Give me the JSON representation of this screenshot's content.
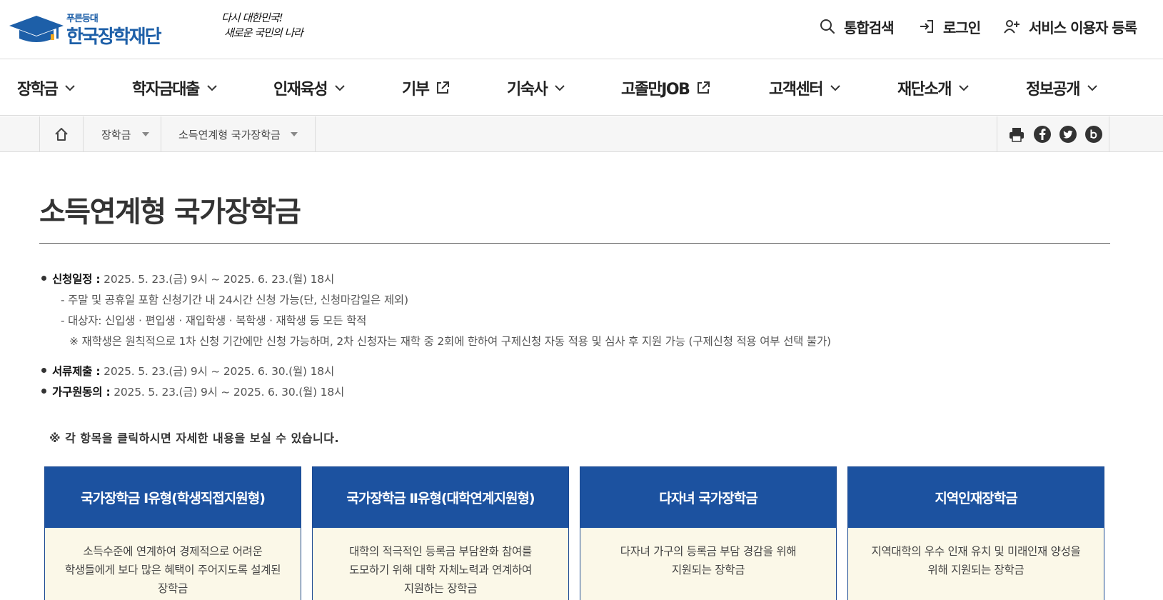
{
  "header": {
    "logo_sub": "푸른등대",
    "logo_main": "한국장학재단",
    "slogan_line1": "다시 대한민국!",
    "slogan_line2": "새로운 국민의 나라",
    "utils": [
      {
        "label": "통합검색",
        "icon": "search-icon"
      },
      {
        "label": "로그인",
        "icon": "login-icon"
      },
      {
        "label": "서비스 이용자 등록",
        "icon": "user-add-icon"
      }
    ]
  },
  "nav": {
    "items": [
      {
        "label": "장학금",
        "icon": "chevron-down-icon"
      },
      {
        "label": "학자금대출",
        "icon": "chevron-down-icon"
      },
      {
        "label": "인재육성",
        "icon": "chevron-down-icon"
      },
      {
        "label": "기부",
        "icon": "external-link-icon"
      },
      {
        "label": "기숙사",
        "icon": "chevron-down-icon"
      },
      {
        "label": "고졸만JOB",
        "icon": "external-link-icon"
      },
      {
        "label": "고객센터",
        "icon": "chevron-down-icon"
      },
      {
        "label": "재단소개",
        "icon": "chevron-down-icon"
      },
      {
        "label": "정보공개",
        "icon": "chevron-down-icon"
      }
    ]
  },
  "breadcrumb": {
    "home_icon": "home-icon",
    "items": [
      "장학금",
      "소득연계형 국가장학금"
    ],
    "share_icons": [
      "print-icon",
      "facebook-icon",
      "twitter-icon",
      "blog-icon"
    ]
  },
  "main": {
    "title": "소득연계형 국가장학금",
    "schedule": [
      {
        "label": "신청일정 :",
        "value": " 2025. 5. 23.(금) 9시 ~ 2025. 6. 23.(월) 18시"
      },
      {
        "label": "서류제출 :",
        "value": " 2025. 5. 23.(금) 9시 ~ 2025. 6. 30.(월) 18시"
      },
      {
        "label": "가구원동의 :",
        "value": " 2025. 5. 23.(금) 9시 ~ 2025. 6. 30.(월) 18시"
      }
    ],
    "sub_lines": [
      "- 주말 및 공휴일 포함 신청기간 내 24시간 신청 가능(단, 신청마감일은 제외)",
      "- 대상자: 신입생 · 편입생 · 재입학생 · 복학생 · 재학생 등 모든 학적",
      "※ 재학생은 원칙적으로 1차 신청 기간에만 신청 가능하며, 2차 신청자는 재학 중 2회에 한하여 구제신청 자동 적용 및 심사 후 지원 가능 (구제신청 적용 여부 선택 불가)"
    ],
    "notice": "※ 각 항목을 클릭하시면 자세한 내용을 보실 수 있습니다.",
    "cards": [
      {
        "title": "국가장학금 Ⅰ유형(학생직접지원형)",
        "desc": [
          "소득수준에 연계하여 경제적으로 어려운",
          "학생들에게 보다 많은 혜택이 주어지도록 설계된",
          "장학금"
        ]
      },
      {
        "title": "국가장학금 Ⅱ유형(대학연계지원형)",
        "desc": [
          "대학의 적극적인 등록금 부담완화 참여를",
          "도모하기 위해 대학 자체노력과 연계하여",
          "지원하는 장학금"
        ]
      },
      {
        "title": "다자녀 국가장학금",
        "desc": [
          "다자녀 가구의 등록금 부담 경감을 위해",
          "지원되는 장학금",
          ""
        ]
      },
      {
        "title": "지역인재장학금",
        "desc": [
          "지역대학의 우수 인재 유치 및 미래인재 양성을",
          "위해 지원되는 장학금",
          ""
        ]
      }
    ]
  },
  "colors": {
    "brand_blue": "#1d5fa8",
    "card_header": "#1c52a0",
    "card_body": "#fbf8e8"
  }
}
